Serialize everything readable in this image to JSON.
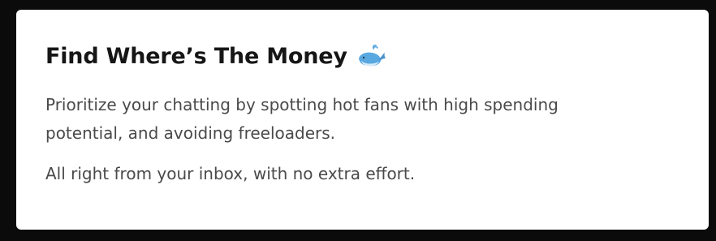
{
  "card": {
    "title": "Find Where’s The Money",
    "title_icon": "whale-icon",
    "description_line_1": "Prioritize your chatting by spotting hot fans with high spending",
    "description_line_2": "potential, and avoiding freeloaders.",
    "footer_text": "All right from your inbox, with no extra effort."
  },
  "colors": {
    "background": "#0b0b0b",
    "card": "#ffffff",
    "title": "#161616",
    "body_text": "#4a4a4a",
    "whale": "#5aa8e0"
  }
}
